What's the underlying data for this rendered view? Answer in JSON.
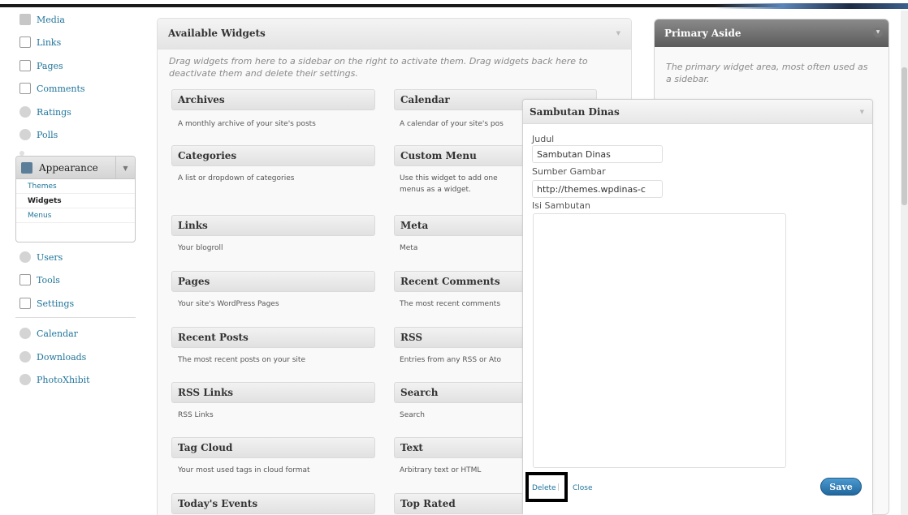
{
  "menu": {
    "items": [
      {
        "label": "Media",
        "icon": "media-icon"
      },
      {
        "label": "Links",
        "icon": "links-icon"
      },
      {
        "label": "Pages",
        "icon": "pages-icon"
      },
      {
        "label": "Comments",
        "icon": "comments-icon"
      },
      {
        "label": "Ratings",
        "icon": "ratings-icon"
      },
      {
        "label": "Polls",
        "icon": "polls-icon"
      }
    ],
    "appearance": {
      "label": "Appearance",
      "submenu": [
        "Themes",
        "Widgets",
        "Menus"
      ],
      "current": "Widgets"
    },
    "items2": [
      {
        "label": "Users",
        "icon": "users-icon"
      },
      {
        "label": "Tools",
        "icon": "tools-icon"
      },
      {
        "label": "Settings",
        "icon": "settings-icon"
      }
    ],
    "items3": [
      {
        "label": "Calendar",
        "icon": "calendar-icon"
      },
      {
        "label": "Downloads",
        "icon": "downloads-icon"
      },
      {
        "label": "PhotoXhibit",
        "icon": "photoxhibit-icon"
      }
    ]
  },
  "available_widgets": {
    "title": "Available Widgets",
    "description": "Drag widgets from here to a sidebar on the right to activate them. Drag widgets back here to deactivate them and delete their settings.",
    "widgets": [
      {
        "name": "Archives",
        "desc": "A monthly archive of your site's posts"
      },
      {
        "name": "Calendar",
        "desc": "A calendar of your site's pos"
      },
      {
        "name": "Categories",
        "desc": "A list or dropdown of categories"
      },
      {
        "name": "Custom Menu",
        "desc": "Use this widget to add one menus as a widget."
      },
      {
        "name": "Links",
        "desc": "Your blogroll"
      },
      {
        "name": "Meta",
        "desc": "Meta"
      },
      {
        "name": "Pages",
        "desc": "Your site's WordPress Pages"
      },
      {
        "name": "Recent Comments",
        "desc": "The most recent comments"
      },
      {
        "name": "Recent Posts",
        "desc": "The most recent posts on your site"
      },
      {
        "name": "RSS",
        "desc": "Entries from any RSS or Ato"
      },
      {
        "name": "RSS Links",
        "desc": "RSS Links"
      },
      {
        "name": "Search",
        "desc": "Search"
      },
      {
        "name": "Tag Cloud",
        "desc": "Your most used tags in cloud format"
      },
      {
        "name": "Text",
        "desc": "Arbitrary text or HTML"
      },
      {
        "name": "Today's Events",
        "desc": ""
      },
      {
        "name": "Top Rated",
        "desc": ""
      }
    ]
  },
  "primary_aside": {
    "title": "Primary Aside",
    "description": "The primary widget area, most often used as a sidebar."
  },
  "widget_form": {
    "title": "Sambutan Dinas",
    "fields": {
      "judul_label": "Judul",
      "judul_value": "Sambutan Dinas",
      "sumber_label": "Sumber Gambar",
      "sumber_value": "http://themes.wpdinas-c",
      "isi_label": "Isi Sambutan",
      "isi_value": ""
    },
    "delete_label": "Delete",
    "separator": "|",
    "close_label": "Close",
    "save_label": "Save"
  },
  "colors": {
    "link": "#21759b",
    "save_button": "#21679d",
    "aside_header": "#5b5b5b"
  }
}
